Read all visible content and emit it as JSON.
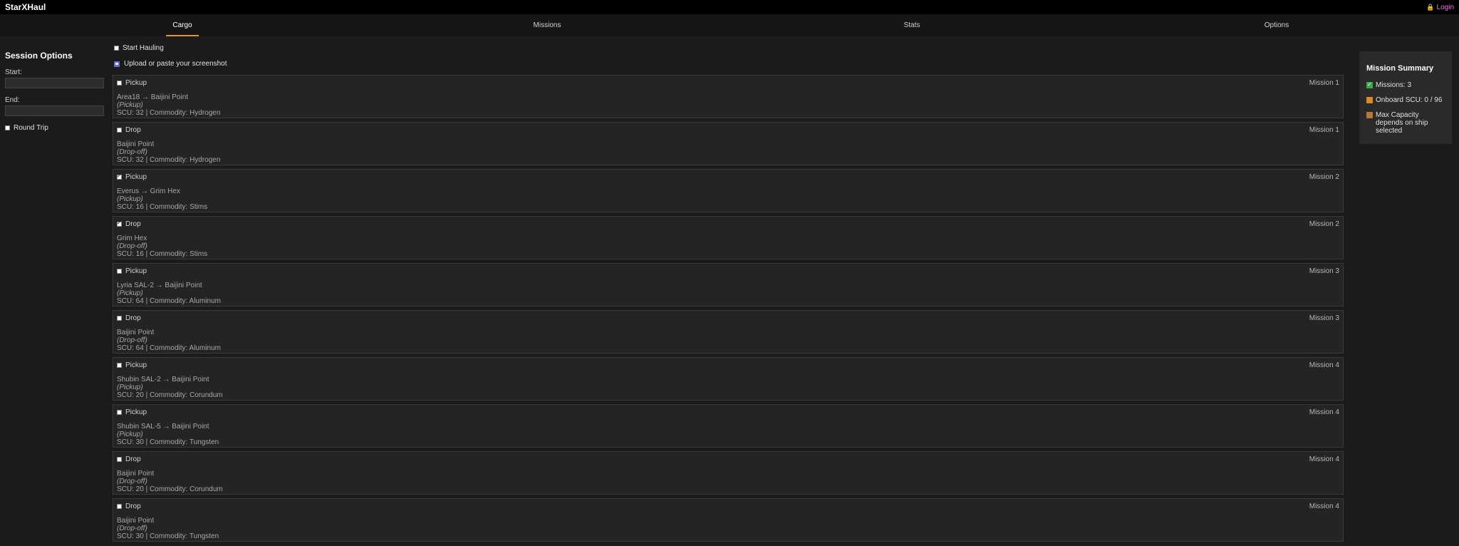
{
  "app": {
    "title": "StarXHaul",
    "login_label": "Login"
  },
  "tabs": [
    {
      "label": "Cargo",
      "active": true
    },
    {
      "label": "Missions",
      "active": false
    },
    {
      "label": "Stats",
      "active": false
    },
    {
      "label": "Options",
      "active": false
    }
  ],
  "sidebar": {
    "title": "Session Options",
    "start_label": "Start:",
    "start_value": "",
    "end_label": "End:",
    "end_value": "",
    "round_trip_label": "Round Trip",
    "round_trip_checked": false
  },
  "main": {
    "start_hauling_label": "Start Hauling",
    "upload_label": "Upload or paste your screenshot"
  },
  "cards": [
    {
      "action": "Pickup",
      "checked": false,
      "mission": "Mission 1",
      "route": "Area18 → Baijini Point",
      "type": "(Pickup)",
      "meta": "SCU: 32 | Commodity: Hydrogen"
    },
    {
      "action": "Drop",
      "checked": false,
      "mission": "Mission 1",
      "route": "Baijini Point",
      "type": "(Drop-off)",
      "meta": "SCU: 32 | Commodity: Hydrogen"
    },
    {
      "action": "Pickup",
      "checked": true,
      "mission": "Mission 2",
      "route": "Everus → Grim Hex",
      "type": "(Pickup)",
      "meta": "SCU: 16 | Commodity: Stims"
    },
    {
      "action": "Drop",
      "checked": true,
      "mission": "Mission 2",
      "route": "Grim Hex",
      "type": "(Drop-off)",
      "meta": "SCU: 16 | Commodity: Stims"
    },
    {
      "action": "Pickup",
      "checked": false,
      "mission": "Mission 3",
      "route": "Lyria SAL-2 → Baijini Point",
      "type": "(Pickup)",
      "meta": "SCU: 64 | Commodity: Aluminum"
    },
    {
      "action": "Drop",
      "checked": false,
      "mission": "Mission 3",
      "route": "Baijini Point",
      "type": "(Drop-off)",
      "meta": "SCU: 64 | Commodity: Aluminum"
    },
    {
      "action": "Pickup",
      "checked": false,
      "mission": "Mission 4",
      "route": "Shubin SAL-2 → Baijini Point",
      "type": "(Pickup)",
      "meta": "SCU: 20 | Commodity: Corundum"
    },
    {
      "action": "Pickup",
      "checked": false,
      "mission": "Mission 4",
      "route": "Shubin SAL-5 → Baijini Point",
      "type": "(Pickup)",
      "meta": "SCU: 30 | Commodity: Tungsten"
    },
    {
      "action": "Drop",
      "checked": false,
      "mission": "Mission 4",
      "route": "Baijini Point",
      "type": "(Drop-off)",
      "meta": "SCU: 20 | Commodity: Corundum"
    },
    {
      "action": "Drop",
      "checked": false,
      "mission": "Mission 4",
      "route": "Baijini Point",
      "type": "(Drop-off)",
      "meta": "SCU: 30 | Commodity: Tungsten"
    }
  ],
  "summary": {
    "title": "Mission Summary",
    "missions": "Missions: 3",
    "onboard": "Onboard SCU: 0 / 96",
    "capacity_title": "Max Capacity",
    "capacity_note": "depends on ship selected"
  },
  "colors": {
    "accent": "#e8952a",
    "login": "#e07bd8",
    "background": "#1b1b1b"
  }
}
